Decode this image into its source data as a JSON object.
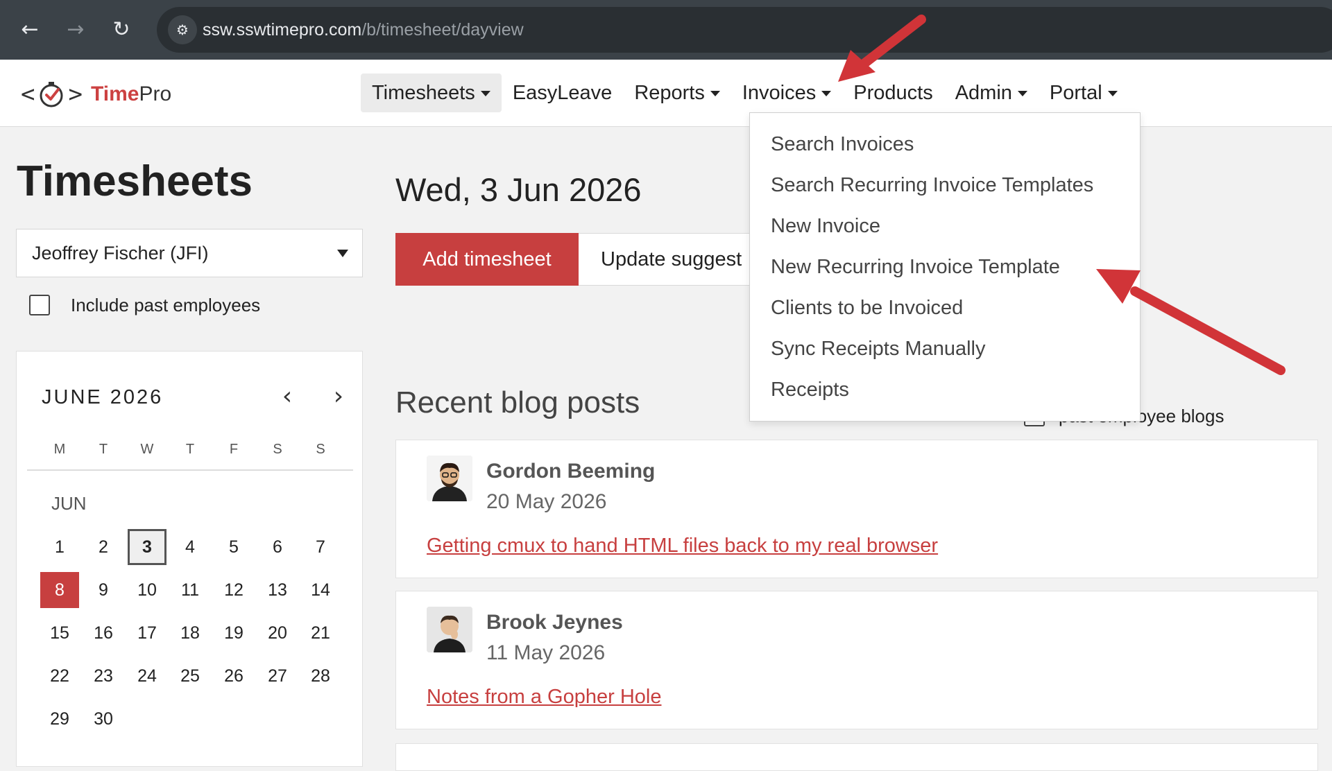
{
  "browser": {
    "url_host": "ssw.sswtimepro.com",
    "url_path": "/b/timesheet/dayview"
  },
  "app": {
    "brand_time": "Time",
    "brand_pro": "Pro",
    "nav": [
      {
        "label": "Timesheets",
        "has_caret": true,
        "active": true
      },
      {
        "label": "EasyLeave",
        "has_caret": false
      },
      {
        "label": "Reports",
        "has_caret": true
      },
      {
        "label": "Invoices",
        "has_caret": true
      },
      {
        "label": "Products",
        "has_caret": false
      },
      {
        "label": "Admin",
        "has_caret": true
      },
      {
        "label": "Portal",
        "has_caret": true
      }
    ]
  },
  "sidebar": {
    "title": "Timesheets",
    "employee": "Jeoffrey Fischer (JFI)",
    "include_past_label": "Include past employees",
    "include_past_checked": false
  },
  "calendar": {
    "month_label": "JUNE 2026",
    "dow": [
      "M",
      "T",
      "W",
      "T",
      "F",
      "S",
      "S"
    ],
    "sub_label": "JUN",
    "days": [
      "1",
      "2",
      "3",
      "4",
      "5",
      "6",
      "7",
      "8",
      "9",
      "10",
      "11",
      "12",
      "13",
      "14",
      "15",
      "16",
      "17",
      "18",
      "19",
      "20",
      "21",
      "22",
      "23",
      "24",
      "25",
      "26",
      "27",
      "28",
      "29",
      "30"
    ],
    "today": "3",
    "selected": "8"
  },
  "main": {
    "date_title": "Wed, 3 Jun 2026",
    "add_button": "Add timesheet",
    "update_button": "Update suggest",
    "blog_heading": "Recent blog posts",
    "past_blogs_label": "past employee blogs",
    "posts": [
      {
        "author": "Gordon Beeming",
        "date": "20 May 2026",
        "title": "Getting cmux to hand HTML files back to my real browser"
      },
      {
        "author": "Brook Jeynes",
        "date": "11 May 2026",
        "title": "Notes from a Gopher Hole"
      }
    ]
  },
  "invoices_menu": {
    "items": [
      "Search Invoices",
      "Search Recurring Invoice Templates",
      "New Invoice",
      "New Recurring Invoice Template",
      "Clients to be Invoiced",
      "Sync Receipts Manually",
      "Receipts"
    ]
  },
  "colors": {
    "accent": "#c73f3f",
    "annotation_arrow": "#d13438",
    "chrome_bg": "#3b4248"
  }
}
